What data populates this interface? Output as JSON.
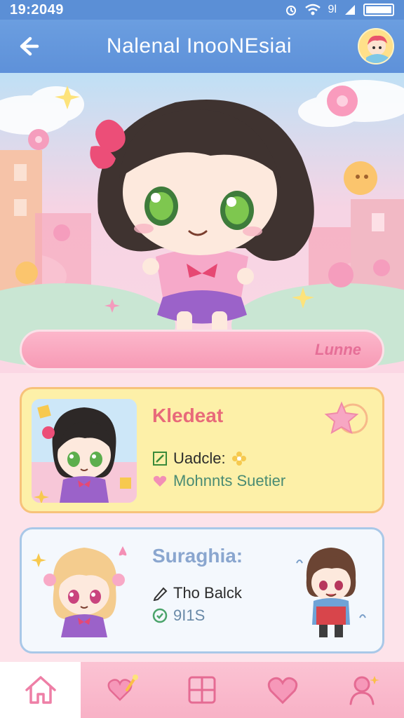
{
  "status_bar": {
    "time": "19:2049",
    "signal_text": "9l"
  },
  "header": {
    "title": "Nalenal InooNEsiai"
  },
  "hero": {
    "name_label": "Lunne"
  },
  "cards": [
    {
      "title": "Kledeat",
      "line1": "Uadcle:",
      "line2": "Mohnnts Suetier"
    },
    {
      "title": "Suraghia:",
      "line1": "Tho Balck",
      "line2": "9I1S"
    }
  ],
  "colors": {
    "header_blue": "#5e91d9",
    "card1_bg": "#fdf0a8",
    "card1_title": "#e86a7a",
    "card2_title": "#8aa6cf",
    "nav_pink": "#f8b1c6",
    "accent_pink": "#e66e97"
  },
  "icons": {
    "header_back": "arrow-left-icon",
    "header_avatar": "profile-avatar-icon",
    "card1_line1": "pencil-icon",
    "card1_line2": "heart-icon",
    "card2_line1": "pencil-icon",
    "card2_line2": "circle-check-icon",
    "nav": [
      "home-icon",
      "heart-wand-icon",
      "grid-icon",
      "heart-icon",
      "profile-icon"
    ]
  },
  "bottom_nav": {
    "active_index": 0
  }
}
